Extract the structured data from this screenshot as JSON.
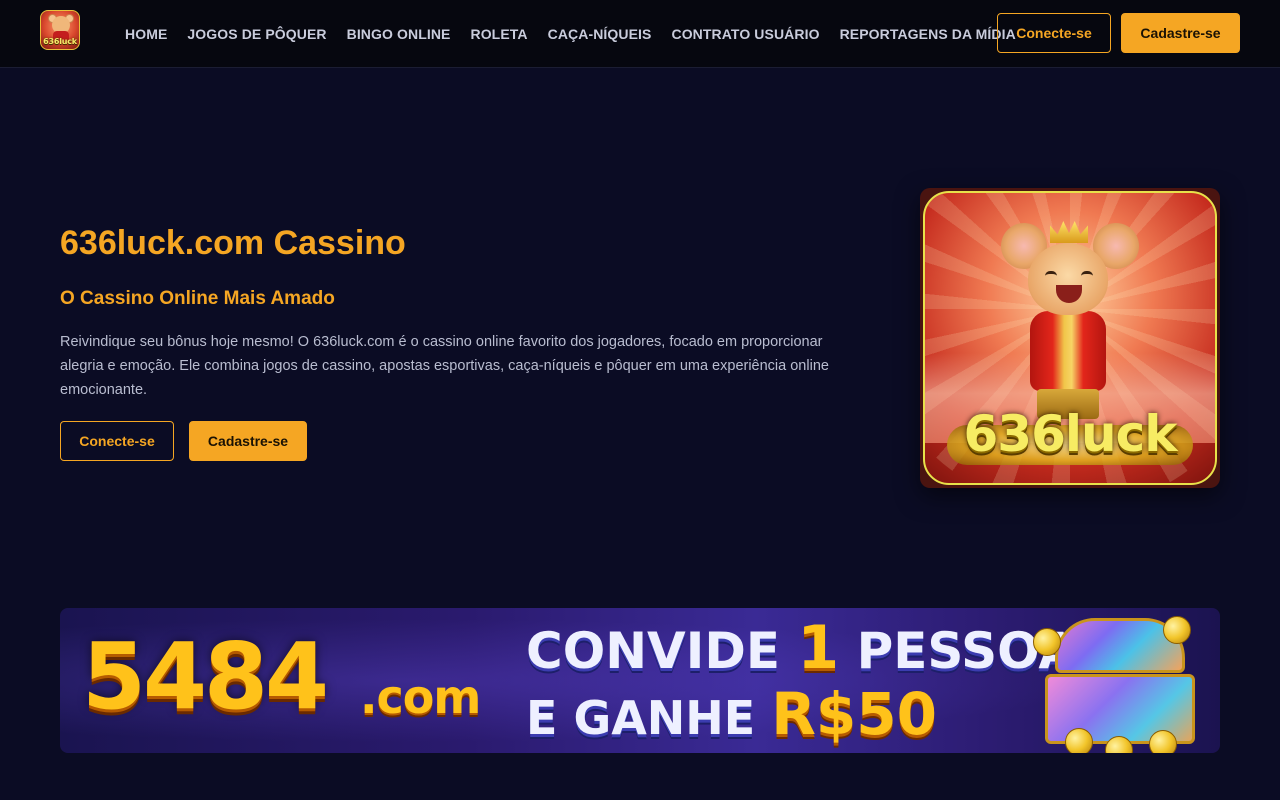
{
  "header": {
    "logo_text": "636luck",
    "nav": [
      {
        "label": "HOME"
      },
      {
        "label": "JOGOS DE PÔQUER"
      },
      {
        "label": "BINGO ONLINE"
      },
      {
        "label": "ROLETA"
      },
      {
        "label": "CAÇA-NÍQUEIS"
      },
      {
        "label": "CONTRATO USUÁRIO"
      },
      {
        "label": "REPORTAGENS DA MÍDIA"
      }
    ],
    "login_label": "Conecte-se",
    "register_label": "Cadastre-se"
  },
  "hero": {
    "title": "636luck.com Cassino",
    "subtitle": "O Cassino Online Mais Amado",
    "description": "Reivindique seu bônus hoje mesmo! O 636luck.com é o cassino online favorito dos jogadores, focado em proporcionar alegria e emoção. Ele combina jogos de cassino, apostas esportivas, caça-níqueis e pôquer em uma experiência online emocionante.",
    "login_label": "Conecte-se",
    "register_label": "Cadastre-se",
    "image_brand_text": "636luck"
  },
  "promo_banner": {
    "domain_main": "5484",
    "domain_suffix": ".com",
    "line1_prefix": "CONVIDE ",
    "line1_number": "1",
    "line1_suffix": " PESSOA",
    "line2_prefix": "E GANHE ",
    "line2_amount": "R$50"
  },
  "colors": {
    "accent": "#f5a623",
    "background": "#0b0c24",
    "header_background": "#06070f",
    "text_muted": "#b9bdd0"
  }
}
